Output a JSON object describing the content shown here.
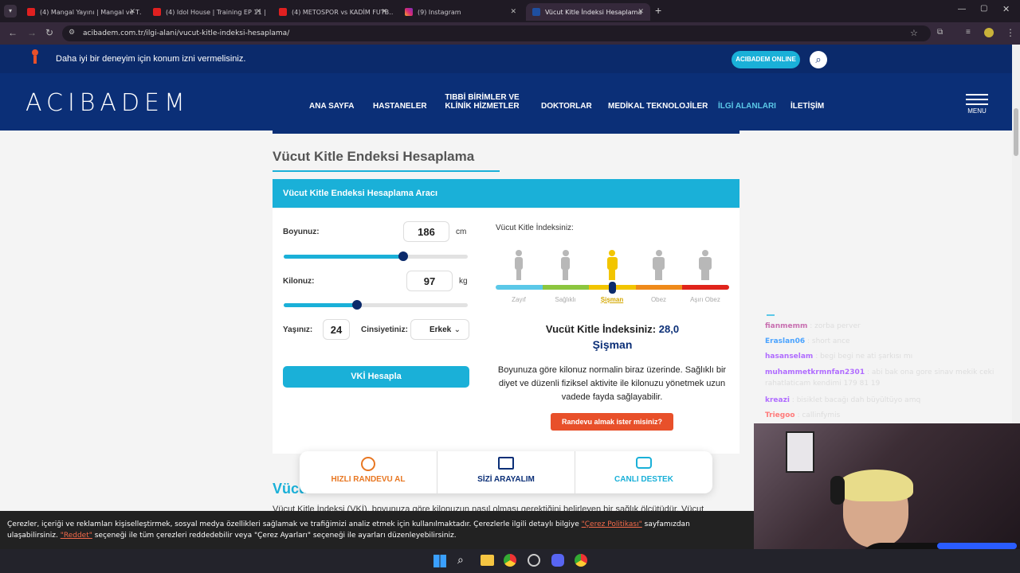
{
  "browser": {
    "tabs": [
      {
        "title": "(4) Mangal Yayını | Mangal ve T…",
        "icon": "youtube-icon"
      },
      {
        "title": "(4) Idol House | Training EP 11 |",
        "icon": "youtube-icon"
      },
      {
        "title": "(4) METOSPOR vs KADİM FUTB…",
        "icon": "youtube-icon"
      },
      {
        "title": "(9) Instagram",
        "icon": "instagram-icon"
      },
      {
        "title": "Vücut Kitle İndeksi Hesaplama",
        "icon": "acibadem-icon"
      }
    ],
    "url": "acibadem.com.tr/ilgi-alani/vucut-kitle-indeksi-hesaplama/"
  },
  "site": {
    "location_prompt": "Daha iyi bir deneyim için konum izni vermelisiniz.",
    "online_label": "ACIBADEM ONLINE",
    "logo": "ACIBADEM",
    "nav": [
      "ANA SAYFA",
      "HASTANELER",
      "TIBBİ BİRİMLER VE KLİNİK HİZMETLER",
      "DOKTORLAR",
      "MEDİKAL TEKNOLOJİLER",
      "İLGİ ALANLARI",
      "İLETİŞİM"
    ],
    "menu_label": "MENU"
  },
  "page": {
    "title": "Vücut Kitle Endeksi Hesaplama",
    "tool_title": "Vücut Kitle Endeksi Hesaplama Aracı",
    "height_label": "Boyunuz:",
    "height_value": "186",
    "height_unit": "cm",
    "height_fraction": 0.65,
    "weight_label": "Kilonuz:",
    "weight_value": "97",
    "weight_unit": "kg",
    "weight_fraction": 0.4,
    "age_label": "Yaşınız:",
    "age_value": "24",
    "gender_label": "Cinsiyetiniz:",
    "gender_value": "Erkek",
    "calc_button": "VKİ Hesapla",
    "index_label": "Vücut Kitle İndeksiniz:",
    "categories": [
      "Zayıf",
      "Sağlıklı",
      "Şişman",
      "Obez",
      "Aşırı Obez"
    ],
    "category_colors": [
      "#5bc8e8",
      "#8cc63f",
      "#f2c500",
      "#ef8a1a",
      "#e0241b"
    ],
    "result_label": "Vucüt Kitle İndeksiniz:",
    "result_value": "28,0",
    "result_category": "Şişman",
    "description": "Boyunuza göre kilonuz normalin biraz üzerinde. Sağlıklı bir diyet ve düzenli fiziksel aktivite ile kilonuzu yönetmek uzun vadede fayda sağlayabilir.",
    "appointment_button": "Randevu almak ister misiniz?",
    "section_heading": "Vücut",
    "section_text": "Vücut Kitle İndeksi (VKİ), boyunuza göre kilonuzun nasıl olması gerektiğini belirleyen bir sağlık ölçütüdür. Vücut"
  },
  "quick": [
    {
      "label": "HIZLI RANDEVU AL",
      "icon": "stopwatch-icon",
      "color": "#e87722"
    },
    {
      "label": "SİZİ ARAYALIM",
      "icon": "form-icon",
      "color": "#0b2f77"
    },
    {
      "label": "CANLI DESTEK",
      "icon": "chat-bubbles-icon",
      "color": "#1ab0d8"
    }
  ],
  "cookie": {
    "text1": "Çerezler, içeriği ve reklamları kişiselleştirmek, sosyal medya özellikleri sağlamak ve trafiğimizi analiz etmek için kullanılmaktadır. Çerezlerle ilgili detaylı bilgiye",
    "policy_link": "\"Çerez Politikası\"",
    "text2": "sayfamızdan",
    "text3": "ulaşabilirsiniz.",
    "reject_link": "\"Reddet\"",
    "text4": "seçeneği ile tüm çerezleri reddedebilir veya \"Çerez Ayarları\" seçeneği ile ayarları düzenleyebilirsiniz."
  },
  "chat": [
    {
      "user": "fianmemm",
      "msg": "zorba perver",
      "color": "#c86fb0"
    },
    {
      "user": "Eraslan06",
      "msg": "short ance",
      "color": "#4aa3ff"
    },
    {
      "user": "hasanselam",
      "msg": "begi begi ne ati şarkısı mı",
      "color": "#b06cff"
    },
    {
      "user": "muhammetkrmnfan2301",
      "msg": "abi bak ona gore sinav mekik ceki rahatlaticam kendimi 179 81 19",
      "color": "#b06cff"
    },
    {
      "user": "kreazi",
      "msg": "bisiklet bacağı dah büyültüyo amq",
      "color": "#b06cff"
    },
    {
      "user": "Triegoo",
      "msg": "callinfymis",
      "color": "#ff7a7a"
    }
  ]
}
